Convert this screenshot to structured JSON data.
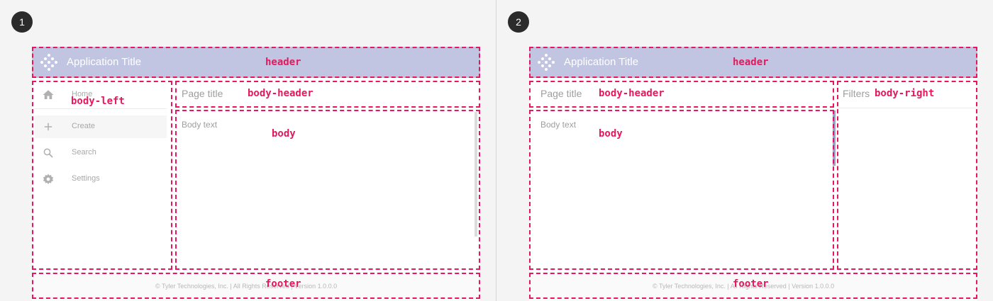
{
  "panels": [
    {
      "number": "1",
      "app_title": "Application Title",
      "labels": {
        "header": "header",
        "body_left": "body-left",
        "body_header": "body-header",
        "body": "body",
        "footer": "footer"
      },
      "nav": [
        {
          "label": "Home",
          "icon": "home-icon"
        },
        {
          "label": "Create",
          "icon": "plus-icon"
        },
        {
          "label": "Search",
          "icon": "search-icon"
        },
        {
          "label": "Settings",
          "icon": "gear-icon"
        }
      ],
      "page_title": "Page title",
      "body_text": "Body text",
      "footer_text": "© Tyler Technologies, Inc. | All Rights Reserved | Version 1.0.0.0"
    },
    {
      "number": "2",
      "app_title": "Application Title",
      "labels": {
        "header": "header",
        "body_header": "body-header",
        "body": "body",
        "body_right": "body-right",
        "footer": "footer"
      },
      "page_title": "Page title",
      "body_text": "Body text",
      "filters_title": "Filters",
      "footer_text": "© Tyler Technologies, Inc. | All Rights Reserved | Version 1.0.0.0"
    }
  ],
  "colors": {
    "annotation": "#e8175d",
    "header_bg": "#c2c5e2",
    "badge_bg": "#2b2b2b"
  }
}
